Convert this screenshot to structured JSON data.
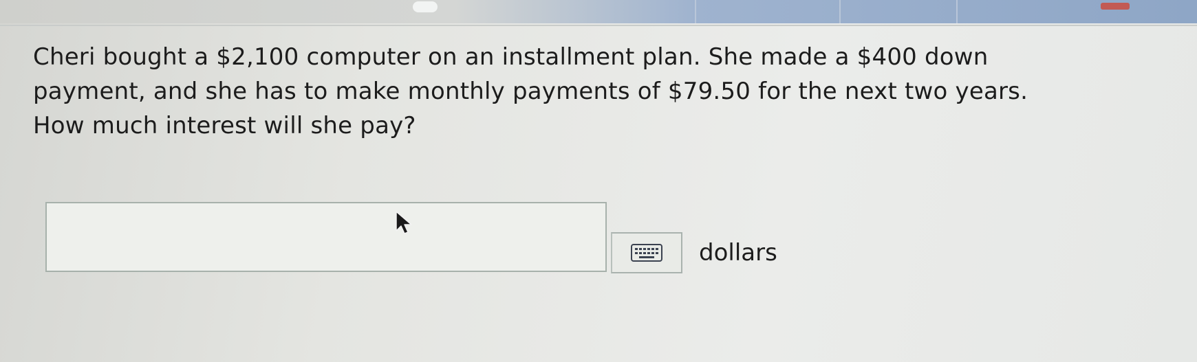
{
  "question": {
    "line1": "Cheri bought a $2,100 computer on an installment plan.  She made a $400 down",
    "line2": "payment, and she has to make monthly payments of $79.50 for the next two years.",
    "line3": "How much interest will she pay?"
  },
  "answer": {
    "value": "",
    "unit": "dollars"
  },
  "icons": {
    "keyboard": "keyboard-icon",
    "cursor": "mouse-pointer-icon"
  }
}
